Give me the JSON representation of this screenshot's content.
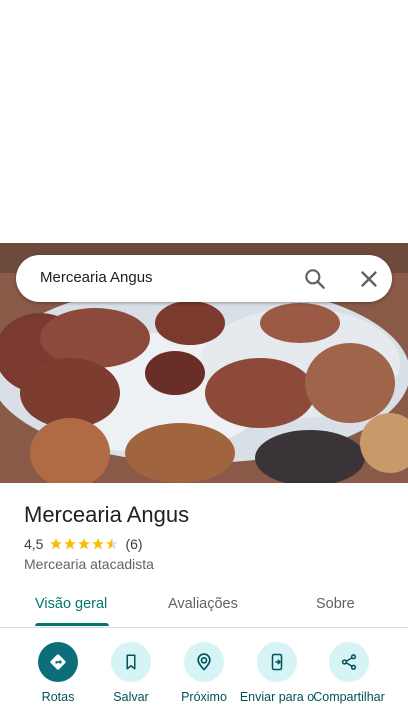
{
  "search": {
    "query": "Mercearia Angus"
  },
  "place": {
    "name": "Mercearia Angus",
    "rating": "4,5",
    "rating_value": 4.5,
    "review_count": "(6)",
    "category": "Mercearia atacadista"
  },
  "tabs": [
    {
      "label": "Visão geral",
      "active": true
    },
    {
      "label": "Avaliações",
      "active": false
    },
    {
      "label": "Sobre",
      "active": false
    }
  ],
  "actions": [
    {
      "label": "Rotas",
      "icon": "directions-icon"
    },
    {
      "label": "Salvar",
      "icon": "bookmark-icon"
    },
    {
      "label": "Próximo",
      "icon": "nearby-icon"
    },
    {
      "label": "Enviar para o",
      "icon": "send-to-phone-icon"
    },
    {
      "label": "Compartilhar",
      "icon": "share-icon"
    }
  ],
  "colors": {
    "accent": "#00796b",
    "primary_action": "#0b6e7a",
    "star": "#fbbc04"
  }
}
